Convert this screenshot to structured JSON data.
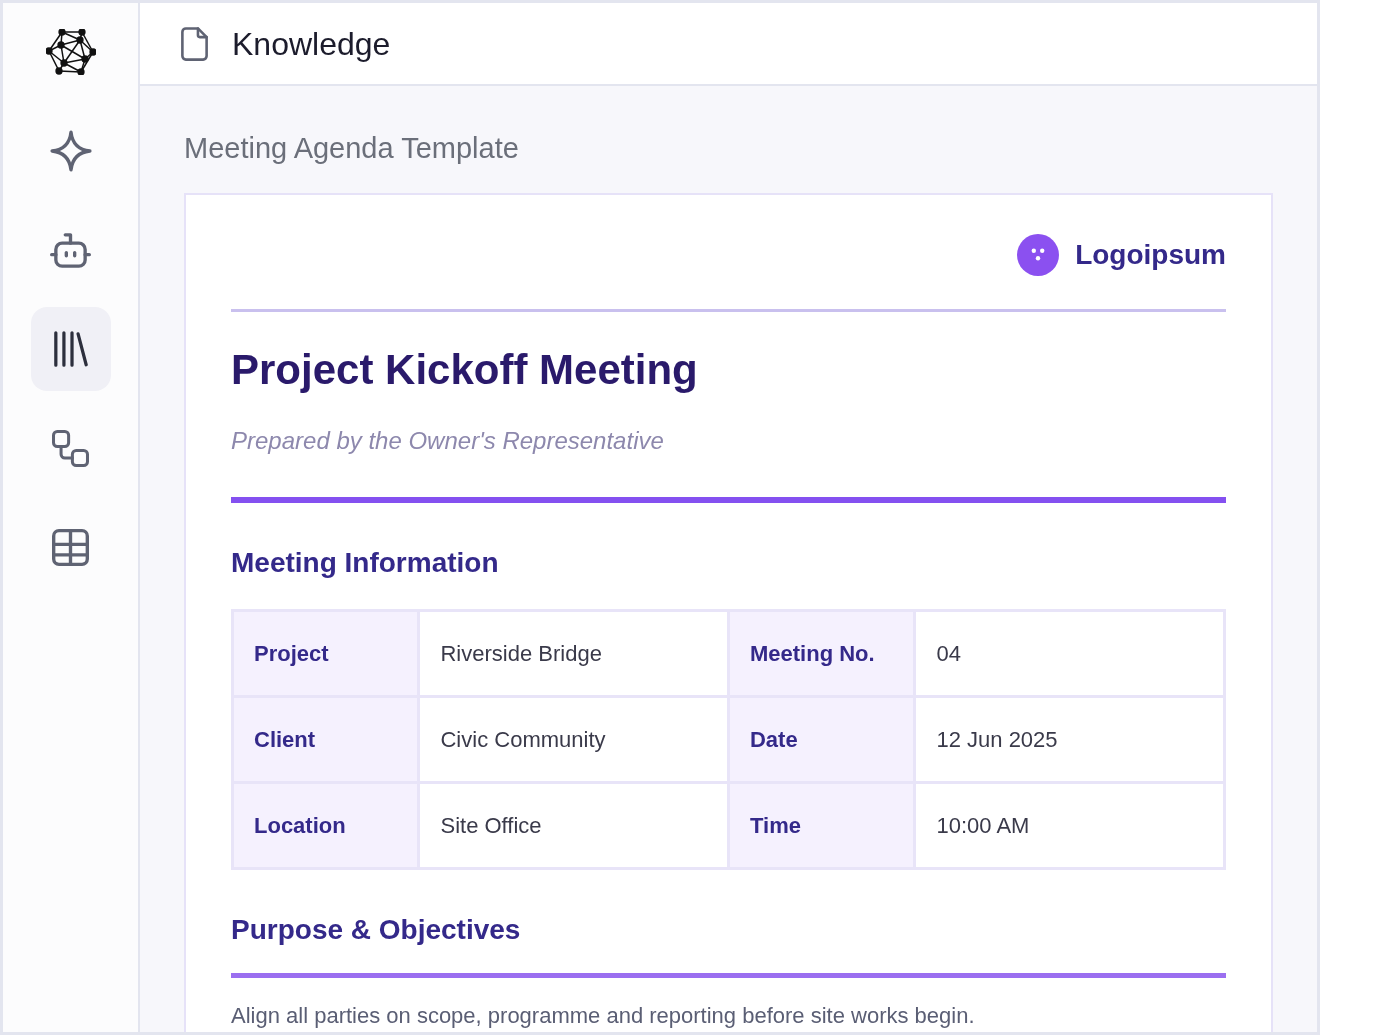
{
  "sidebar": {
    "items": [
      {
        "kind": "sparkle",
        "selected": false
      },
      {
        "kind": "robot",
        "selected": false
      },
      {
        "kind": "library",
        "selected": true
      },
      {
        "kind": "workflow",
        "selected": false
      },
      {
        "kind": "table",
        "selected": false
      }
    ]
  },
  "header": {
    "title": "Knowledge"
  },
  "page": {
    "title": "Meeting Agenda Template"
  },
  "document": {
    "brand": "Logoipsum",
    "title": "Project Kickoff Meeting",
    "subtitle": "Prepared by the Owner's Representative",
    "blocks": [
      {
        "kind": "heading",
        "text": "Meeting Information"
      },
      {
        "kind": "table",
        "rows": [
          {
            "cells": [
              {
                "label": "Project",
                "value": "Riverside Bridge"
              },
              {
                "label": "Meeting No.",
                "value": "04"
              }
            ]
          },
          {
            "cells": [
              {
                "label": "Client",
                "value": "Civic Community"
              },
              {
                "label": "Date",
                "value": "12 Jun 2025"
              }
            ]
          },
          {
            "cells": [
              {
                "label": "Location",
                "value": "Site Office"
              },
              {
                "label": "Time",
                "value": "10:00 AM"
              }
            ]
          }
        ]
      },
      {
        "kind": "heading",
        "text": "Purpose & Objectives"
      },
      {
        "kind": "rule"
      },
      {
        "kind": "text",
        "text": "Align all parties on scope, programme and reporting before site works begin."
      }
    ]
  }
}
